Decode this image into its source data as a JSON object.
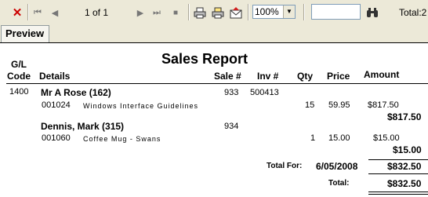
{
  "toolbar": {
    "page_indicator": "1 of 1",
    "zoom": "100%",
    "search_value": "",
    "total_label": "Total:2"
  },
  "tabs": [
    {
      "label": "Preview"
    }
  ],
  "report": {
    "title": "Sales Report",
    "headers": {
      "gl_code_line1": "G/L",
      "gl_code_line2": "Code",
      "details": "Details",
      "sale": "Sale #",
      "inv": "Inv #",
      "qty": "Qty",
      "price": "Price",
      "amount": "Amount"
    },
    "gl_code": "1400",
    "customers": [
      {
        "name": "Mr A Rose (162)",
        "sale": "933",
        "inv": "500413",
        "item_code": "001024",
        "item_desc": "Windows Interface Guidelines",
        "qty": "15",
        "price": "59.95",
        "amount": "$817.50",
        "subtotal": "$817.50"
      },
      {
        "name": "Dennis, Mark (315)",
        "sale": "934",
        "inv": "",
        "item_code": "001060",
        "item_desc": "Coffee Mug - Swans",
        "qty": "1",
        "price": "15.00",
        "amount": "$15.00",
        "subtotal": "$15.00"
      }
    ],
    "total_for_label": "Total For:",
    "total_for_date": "6/05/2008",
    "total_for_amount": "$832.50",
    "grand_total_label": "Total:",
    "grand_total_amount": "$832.50"
  },
  "colors": {
    "stop_icon": "#cc0000",
    "toolbar_bg": "#ece9d8"
  }
}
